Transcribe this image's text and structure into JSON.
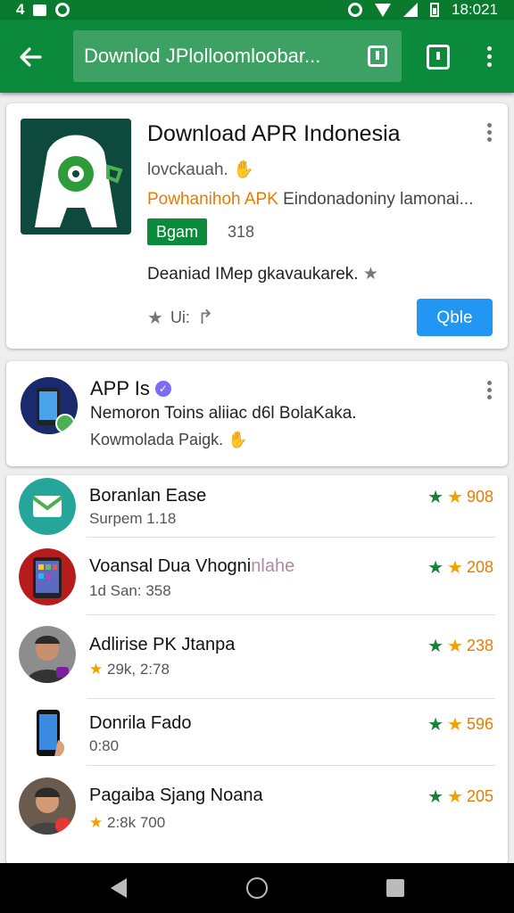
{
  "status_bar": {
    "left_text": "4",
    "time": "18:021"
  },
  "app_bar": {
    "url": "Downlod JPlolloomloobar...",
    "back_icon": "arrow-left-icon"
  },
  "featured": {
    "title": "Download APR Indonesia",
    "developer": "lovckauah.",
    "category_prefix": "Powhanihoh APK",
    "category_rest": "Eindonadoniny lamonai...",
    "badge": "Bgam",
    "count": "318",
    "description": "Deaniad  IMep gkavaukarek.",
    "footer_label": "Ui:",
    "install_label": "Qble"
  },
  "sponsor": {
    "title": "APP Is",
    "description": "Nemoron Toins aliiac d6l BolaKaka.",
    "subtitle": "Kowmolada Paigk."
  },
  "list": [
    {
      "title": "Boranlan Ease",
      "subtitle": "Surpem 1.18",
      "rating": "908",
      "icon": "message-app-icon"
    },
    {
      "title": "Voansal Dua Vhogni",
      "title_faded": "nlahe",
      "subtitle": "1d San: 358",
      "rating": "208",
      "icon": "phone-apps-icon"
    },
    {
      "title": "Adlirise PK Jtanpa",
      "subtitle": "29k, 2:78",
      "subtitle_star": true,
      "rating": "238",
      "icon": "person-avatar-icon"
    },
    {
      "title": "Donrila Fado",
      "subtitle": "0:80",
      "rating": "596",
      "icon": "smartphone-icon"
    },
    {
      "title": "Pagaiba Sjang Noana",
      "subtitle": "2:8k 700",
      "subtitle_star": true,
      "rating": "205",
      "icon": "person-avatar-icon"
    }
  ],
  "colors": {
    "brand_green": "#0c8a3c",
    "install_blue": "#2196f3",
    "rating_orange": "#e67c00"
  }
}
